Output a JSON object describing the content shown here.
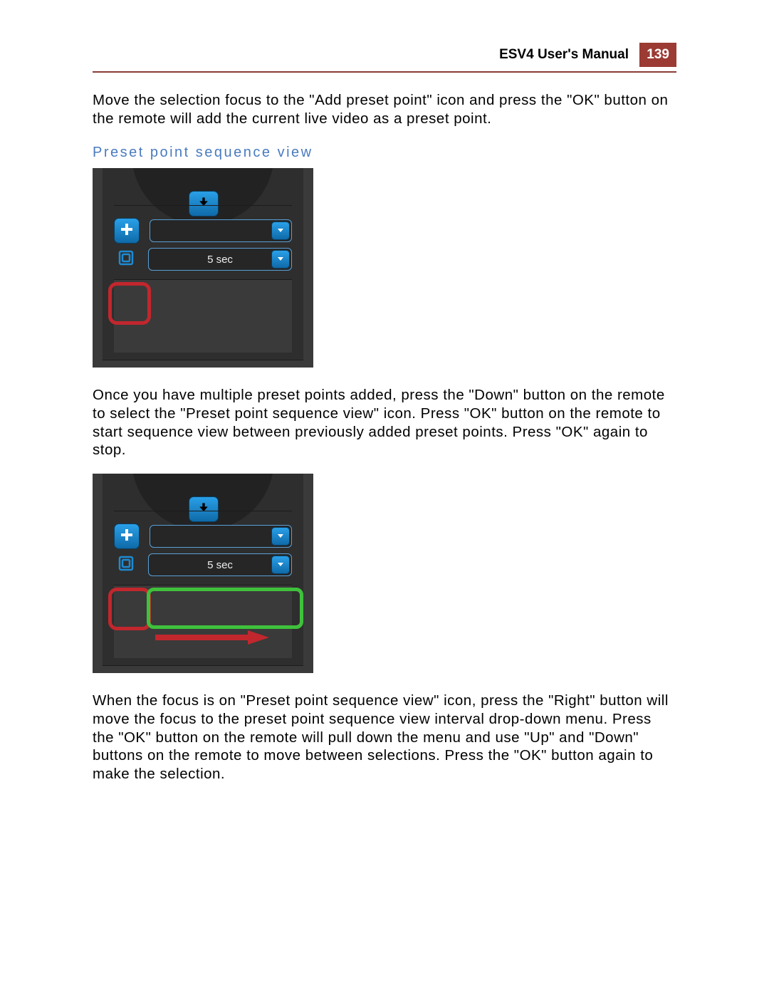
{
  "header": {
    "title": "ESV4 User's Manual",
    "page_number": "139"
  },
  "paragraphs": {
    "p1": "Move the selection focus to the \"Add preset point\" icon and press the \"OK\" button on the remote will add the current live video as a preset point.",
    "p2": "Once you have multiple preset points added, press the \"Down\" button on the remote to select the \"Preset point sequence view\" icon. Press \"OK\" button on the remote to start sequence view between previously added preset points. Press \"OK\" again to stop.",
    "p3": "When the focus is on \"Preset point sequence view\" icon, press the \"Right\" button will move the focus to the preset point sequence view interval drop-down menu. Press the \"OK\" button on the remote will pull down the menu and use \"Up\" and \"Down\" buttons on the remote to move between selections. Press the \"OK\" button again to make the selection."
  },
  "section_heading": "Preset point sequence view",
  "ui_panel1": {
    "preset_dropdown_value": "",
    "interval_dropdown_value": "5 sec"
  },
  "ui_panel2": {
    "preset_dropdown_value": "",
    "interval_dropdown_value": "5 sec"
  },
  "icons": {
    "arrow_left": "arrow-left-icon",
    "arrow_right": "arrow-right-icon",
    "arrow_down": "arrow-down-icon",
    "plus": "plus-icon",
    "sequence": "sequence-view-icon",
    "chevron_down": "chevron-down-icon",
    "red_arrow": "annotation-arrow-right"
  },
  "colors": {
    "accent_blue": "#1e8ad1",
    "highlight_red": "#c1272d",
    "highlight_green": "#3fc13b",
    "header_red": "#9b3b33",
    "link_blue": "#4a7bbf"
  }
}
